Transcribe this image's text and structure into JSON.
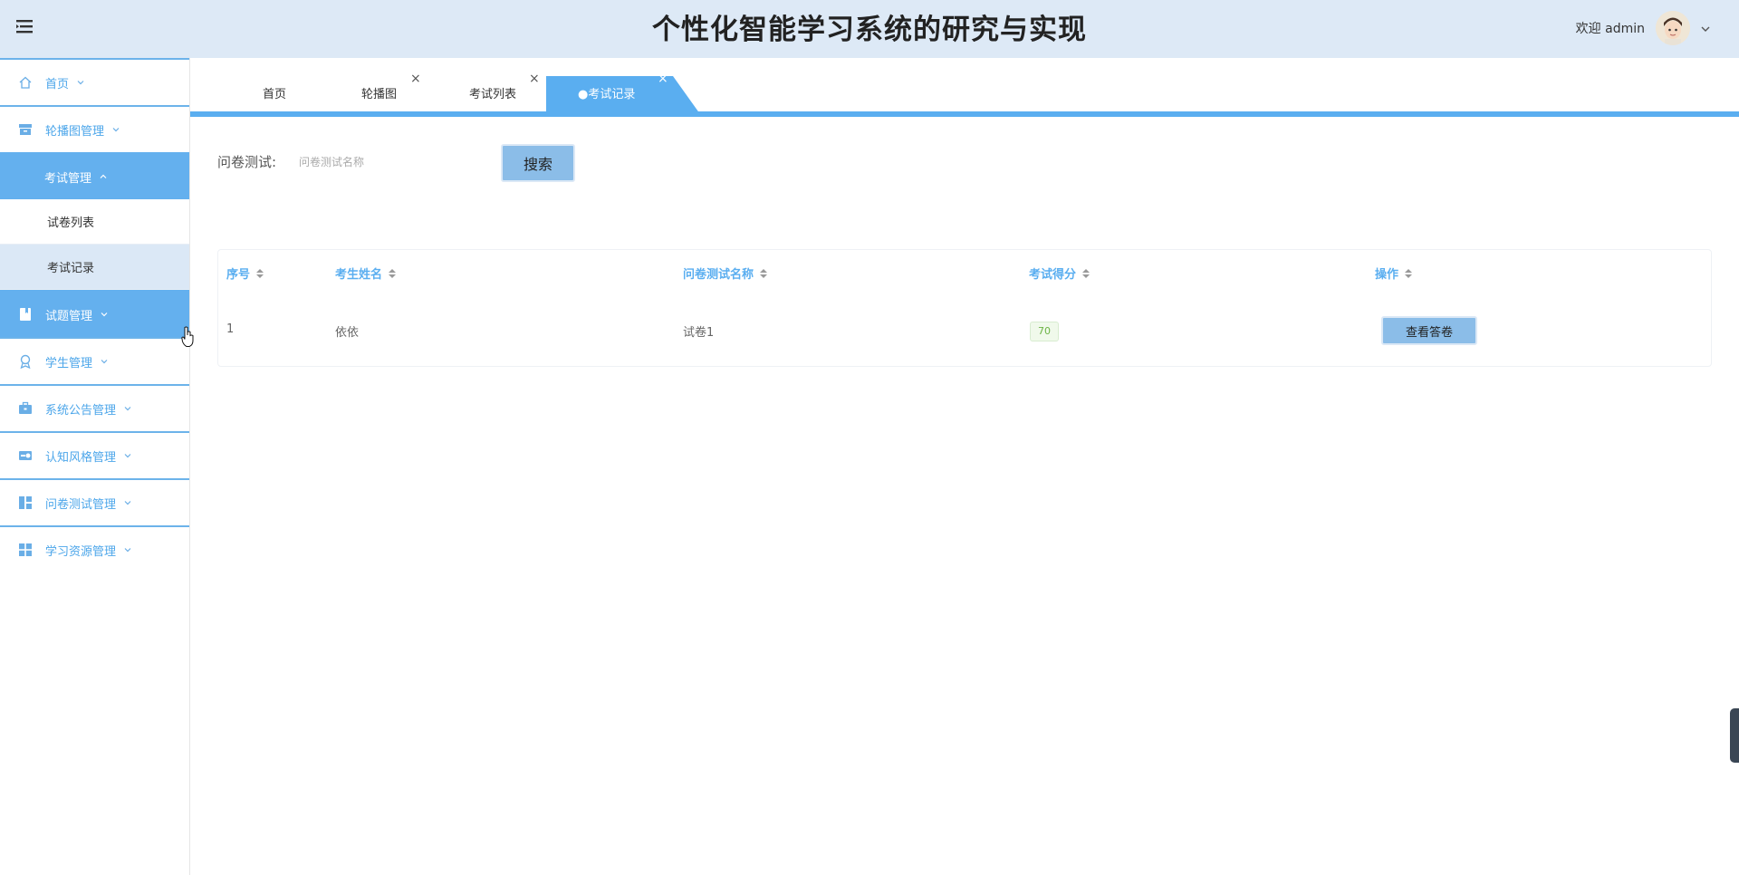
{
  "header": {
    "title": "个性化智能学习系统的研究与实现",
    "welcome": "欢迎 admin"
  },
  "sidebar": {
    "items": [
      {
        "label": "首页",
        "icon": "home-icon"
      },
      {
        "label": "轮播图管理",
        "icon": "archive-icon"
      },
      {
        "label": "考试管理",
        "icon": "",
        "expanded": true,
        "children": [
          {
            "label": "试卷列表"
          },
          {
            "label": "考试记录"
          }
        ]
      },
      {
        "label": "试题管理",
        "icon": "book-icon"
      },
      {
        "label": "学生管理",
        "icon": "award-icon"
      },
      {
        "label": "系统公告管理",
        "icon": "briefcase-icon"
      },
      {
        "label": "认知风格管理",
        "icon": "toggle-icon"
      },
      {
        "label": "问卷测试管理",
        "icon": "dashboard-icon"
      },
      {
        "label": "学习资源管理",
        "icon": "grid-icon"
      }
    ]
  },
  "tabs": [
    {
      "label": "首页",
      "closable": false
    },
    {
      "label": "轮播图",
      "closable": true
    },
    {
      "label": "考试列表",
      "closable": true
    },
    {
      "label": "●考试记录",
      "closable": true,
      "active": true
    }
  ],
  "search": {
    "label": "问卷测试:",
    "placeholder": "问卷测试名称",
    "button": "搜索"
  },
  "table": {
    "columns": [
      "序号",
      "考生姓名",
      "问卷测试名称",
      "考试得分",
      "操作"
    ],
    "rows": [
      {
        "index": "1",
        "name": "依依",
        "paper": "试卷1",
        "score": "70",
        "action": "查看答卷"
      }
    ]
  },
  "colors": {
    "header_bg": "#dde9f6",
    "accent": "#5aaef0",
    "active_menu": "#64b0ee",
    "button": "#8bbde8",
    "score_green": "#6cb445"
  }
}
